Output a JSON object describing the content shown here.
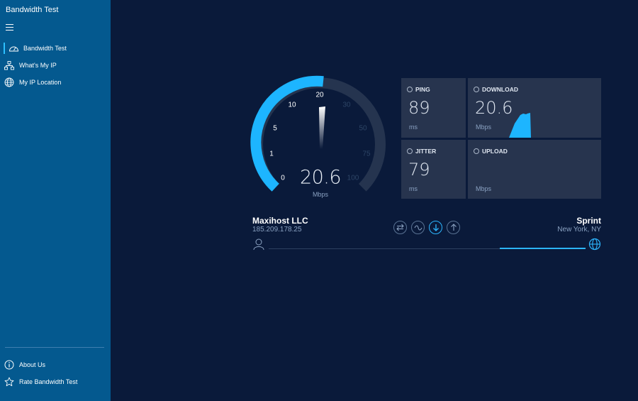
{
  "app": {
    "title": "Bandwidth Test"
  },
  "sidebar": {
    "menu_icon": "hamburger-menu-icon",
    "items": [
      {
        "label": "Bandwidth Test",
        "icon": "speedometer-icon",
        "active": true
      },
      {
        "label": "What's My IP",
        "icon": "network-icon"
      },
      {
        "label": "My IP Location",
        "icon": "globe-icon"
      }
    ],
    "footer_items": [
      {
        "label": "About Us",
        "icon": "info-icon"
      },
      {
        "label": "Rate Bandwidth Test",
        "icon": "star-icon"
      }
    ]
  },
  "gauge": {
    "ticks": [
      "0",
      "1",
      "5",
      "10",
      "20",
      "30",
      "50",
      "75",
      "100"
    ],
    "value": "20.6",
    "unit": "Mbps",
    "needle_value": 20.6
  },
  "stats": {
    "ping": {
      "title": "PING",
      "value": "89",
      "unit": "ms",
      "icon": "ping-icon"
    },
    "download": {
      "title": "DOWNLOAD",
      "value": "20.6",
      "unit": "Mbps",
      "icon": "download-icon"
    },
    "jitter": {
      "title": "JITTER",
      "value": "79",
      "unit": "ms",
      "icon": "jitter-icon"
    },
    "upload": {
      "title": "UPLOAD",
      "value": "",
      "unit": "Mbps",
      "icon": "upload-icon"
    }
  },
  "server": {
    "host": "Maxihost LLC",
    "ip": "185.209.178.25",
    "isp": "Sprint",
    "location": "New York, NY"
  },
  "modes": [
    {
      "icon": "ping-mode-icon"
    },
    {
      "icon": "jitter-mode-icon"
    },
    {
      "icon": "download-mode-icon",
      "active": true
    },
    {
      "icon": "upload-mode-icon"
    }
  ],
  "colors": {
    "accent": "#2cb6ff",
    "sidebar": "#04598f",
    "background": "#0a1a3a",
    "card": "#27344e"
  }
}
